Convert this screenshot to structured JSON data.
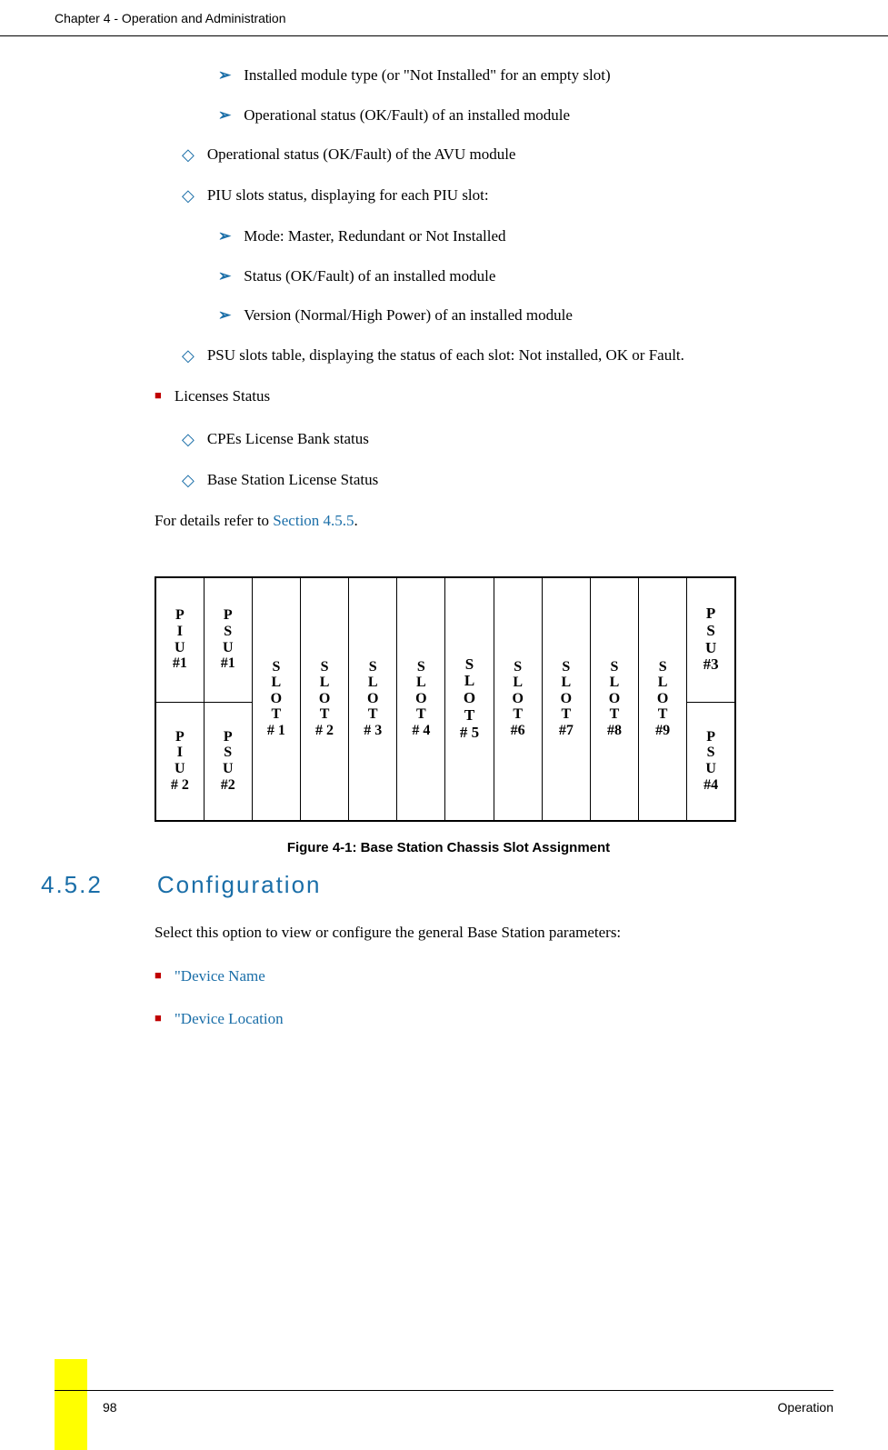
{
  "header": {
    "chapter": "Chapter 4 - Operation and Administration"
  },
  "bullets": {
    "arrow1": "Installed module type (or \"Not Installed\" for an empty slot)",
    "arrow2": "Operational status (OK/Fault) of an installed module",
    "diamond1": "Operational status (OK/Fault) of the AVU module",
    "diamond2": "PIU slots status, displaying for each PIU slot:",
    "arrow3": "Mode: Master, Redundant or Not Installed",
    "arrow4": "Status (OK/Fault) of an installed module",
    "arrow5": "Version (Normal/High Power) of an installed module",
    "diamond3": "PSU slots table, displaying the status of each slot: Not installed, OK or Fault.",
    "square1": "Licenses Status",
    "diamond4": "CPEs License Bank status",
    "diamond5": "Base Station License Status"
  },
  "para_prefix": "For details refer to ",
  "section_link": "Section 4.5.5",
  "chart_data": {
    "type": "table",
    "title": "Base Station Chassis Slot Assignment",
    "layout": "2-row chassis, 13 columns",
    "slots": {
      "top_row": [
        "PIU #1",
        "PSU #1",
        "SLOT #1",
        "SLOT #2",
        "SLOT #3",
        "SLOT #4",
        "SLOT #5",
        "SLOT #6",
        "SLOT #7",
        "SLOT #8",
        "SLOT #9",
        "PSU #3"
      ],
      "bottom_row_left": [
        "PIU #2",
        "PSU #2"
      ],
      "bottom_row_right": [
        "PSU #4"
      ],
      "slots_span_both_rows": true
    },
    "cells": {
      "piu1": "PIU\n#1",
      "psu1": "PSU\n#1",
      "slot1": "SLOT\n#1",
      "slot2": "SLOT\n#2",
      "slot3": "SLOT\n#3",
      "slot4": "SLOT\n#4",
      "slot5": "SLOT\n# 5",
      "slot6": "SLOT\n#6",
      "slot7": "SLOT\n#7",
      "slot8": "SLOT\n#8",
      "slot9": "SLOT\n#9",
      "psu3": "PSU\n#3",
      "piu2": "PIU\n# 2",
      "psu2": "PSU\n#2",
      "psu4": "PSU\n#4"
    }
  },
  "figure_caption": "Figure 4-1: Base Station Chassis Slot Assignment",
  "section": {
    "number": "4.5.2",
    "title": "Configuration",
    "intro": "Select this option to view or configure the general Base Station parameters:",
    "link1": "\"Device Name",
    "link2": "\"Device Location"
  },
  "footer": {
    "page": "98",
    "label": "Operation"
  }
}
